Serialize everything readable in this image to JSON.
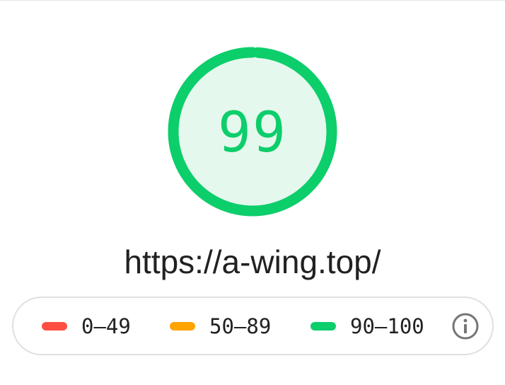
{
  "report": {
    "score": "99",
    "url": "https://a-wing.top/"
  },
  "gauge": {
    "color": "#0cce6b",
    "fill_color": "#e5f8ee",
    "progress": 0.99
  },
  "legend": {
    "items": [
      {
        "label": "0–49",
        "color": "#ff4e42"
      },
      {
        "label": "50–89",
        "color": "#ffa400"
      },
      {
        "label": "90–100",
        "color": "#0cce6b"
      }
    ],
    "info_icon": "info-icon"
  }
}
